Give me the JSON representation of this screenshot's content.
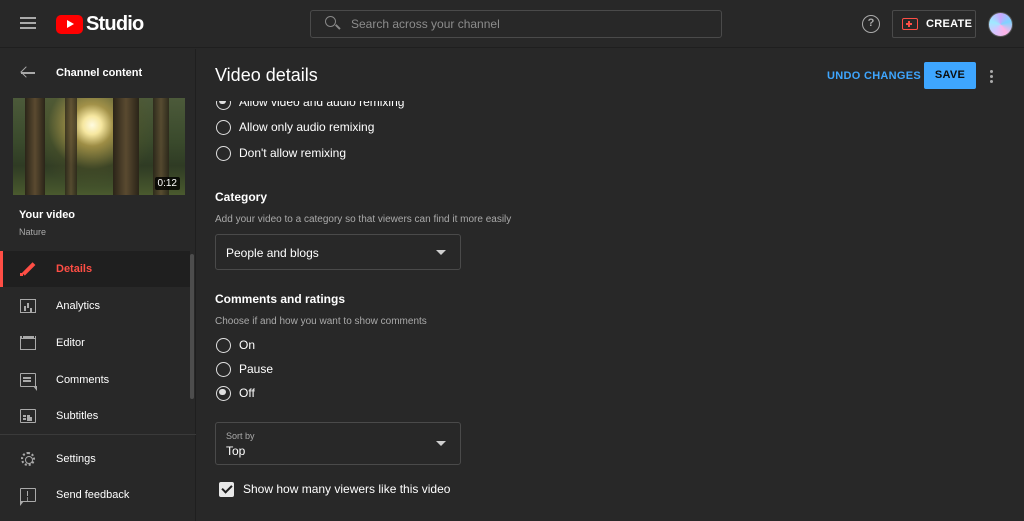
{
  "topbar": {
    "logo_text": "Studio",
    "search_placeholder": "Search across your channel",
    "help_label": "?",
    "create_label": "CREATE"
  },
  "sidebar": {
    "back_label": "Channel content",
    "thumbnail_duration": "0:12",
    "video_title": "Your video",
    "video_name": "Nature",
    "items": [
      {
        "label": "Details",
        "active": true
      },
      {
        "label": "Analytics"
      },
      {
        "label": "Editor"
      },
      {
        "label": "Comments"
      },
      {
        "label": "Subtitles"
      },
      {
        "label": "Settings"
      },
      {
        "label": "Send feedback"
      }
    ]
  },
  "main": {
    "title": "Video details",
    "undo_label": "UNDO CHANGES",
    "save_label": "SAVE",
    "remix_options": [
      {
        "label": "Allow video and audio remixing",
        "checked": true
      },
      {
        "label": "Allow only audio remixing",
        "checked": false
      },
      {
        "label": "Don't allow remixing",
        "checked": false
      }
    ],
    "category": {
      "title": "Category",
      "description": "Add your video to a category so that viewers can find it more easily",
      "selected": "People and blogs"
    },
    "comments": {
      "title": "Comments and ratings",
      "description": "Choose if and how you want to show comments",
      "options": [
        {
          "label": "On",
          "checked": false
        },
        {
          "label": "Pause",
          "checked": false
        },
        {
          "label": "Off",
          "checked": true
        }
      ],
      "sort_caption": "Sort by",
      "sort_value": "Top"
    },
    "show_likes_label": "Show how many viewers like this video",
    "show_likes_checked": true
  },
  "colors": {
    "background": "#282828",
    "accent_blue": "#3ea6ff",
    "accent_red": "#ff4e45",
    "text_secondary": "#aaaaaa"
  }
}
